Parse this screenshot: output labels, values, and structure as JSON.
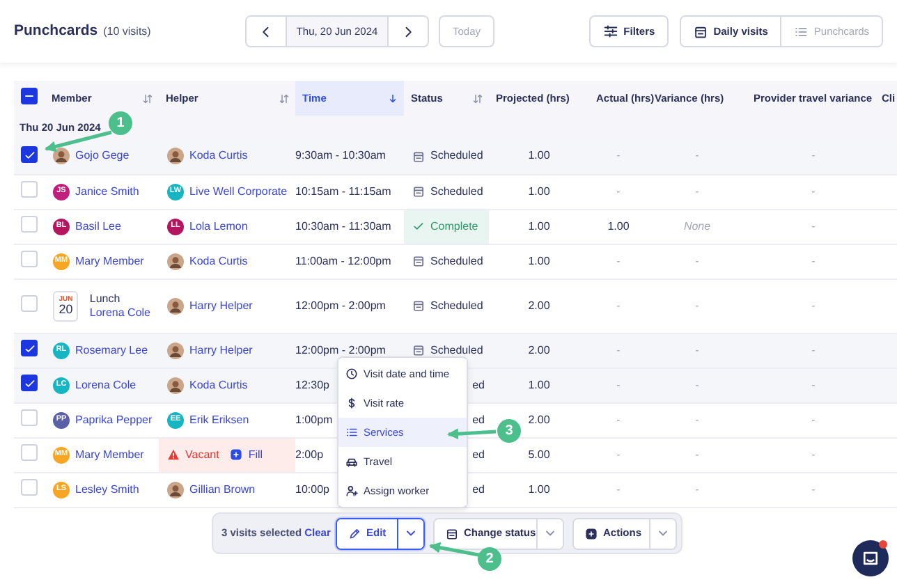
{
  "header": {
    "title": "Punchcards",
    "count": "(10 visits)",
    "date": "Thu, 20 Jun 2024",
    "today": "Today",
    "filters": "Filters",
    "views": [
      {
        "label": "Daily visits",
        "selected": true
      },
      {
        "label": "Punchcards",
        "selected": false
      }
    ]
  },
  "table": {
    "select_all": {
      "indeterminate": true
    },
    "columns": [
      {
        "label": "Member",
        "sortable": true,
        "sorted": false
      },
      {
        "label": "Helper",
        "sortable": true,
        "sorted": false
      },
      {
        "label": "Time",
        "sortable": true,
        "sorted": true
      },
      {
        "label": "Status",
        "sortable": true,
        "sorted": false
      },
      {
        "label": "Projected (hrs)",
        "sortable": false,
        "sorted": false
      },
      {
        "label": "Actual (hrs)",
        "sortable": false,
        "sorted": false
      },
      {
        "label": "Variance (hrs)",
        "sortable": false,
        "sorted": false
      },
      {
        "label": "Provider travel variance",
        "sortable": false,
        "sorted": false
      },
      {
        "label": "Cli",
        "sortable": false,
        "sorted": false
      }
    ],
    "group": "Thu 20 Jun 2024",
    "rows": [
      {
        "checked": true,
        "member": {
          "kind": "photo",
          "name": "Gojo Gege"
        },
        "helper": {
          "kind": "photo",
          "name": "Koda Curtis"
        },
        "time": "9:30am - 10:30am",
        "status": {
          "kind": "scheduled",
          "text": "Scheduled"
        },
        "projected": "1.00",
        "actual": "-",
        "variance": {
          "text": "-",
          "kind": "empty"
        },
        "travel": "-"
      },
      {
        "checked": false,
        "member": {
          "kind": "initials",
          "initials": "JS",
          "color": "#c01f7e",
          "name": "Janice Smith"
        },
        "helper": {
          "kind": "initials",
          "initials": "LW",
          "color": "#16b5c2",
          "name": "Live Well Corporate"
        },
        "time": "10:15am - 11:15am",
        "status": {
          "kind": "scheduled",
          "text": "Scheduled"
        },
        "projected": "1.00",
        "actual": "-",
        "variance": {
          "text": "-",
          "kind": "empty"
        },
        "travel": "-"
      },
      {
        "checked": false,
        "member": {
          "kind": "initials",
          "initials": "BL",
          "color": "#b3165f",
          "name": "Basil Lee"
        },
        "helper": {
          "kind": "initials",
          "initials": "LL",
          "color": "#b3165f",
          "name": "Lola Lemon"
        },
        "time": "10:30am - 11:30am",
        "status": {
          "kind": "complete",
          "text": "Complete"
        },
        "projected": "1.00",
        "actual": "1.00",
        "variance": {
          "text": "None",
          "kind": "none"
        },
        "travel": "-"
      },
      {
        "checked": false,
        "member": {
          "kind": "initials",
          "initials": "MM",
          "color": "#f6a623",
          "name": "Mary Member"
        },
        "helper": {
          "kind": "photo",
          "name": "Koda Curtis"
        },
        "time": "11:00am - 12:00pm",
        "status": {
          "kind": "scheduled",
          "text": "Scheduled"
        },
        "projected": "1.00",
        "actual": "-",
        "variance": {
          "text": "-",
          "kind": "empty"
        },
        "travel": "-"
      },
      {
        "checked": false,
        "member": {
          "kind": "event",
          "month": "JUN",
          "day": "20",
          "label": "Lunch",
          "name": "Lorena Cole"
        },
        "helper": {
          "kind": "photo",
          "name": "Harry Helper"
        },
        "time": "12:00pm - 2:00pm",
        "status": {
          "kind": "scheduled",
          "text": "Scheduled"
        },
        "projected": "2.00",
        "actual": "-",
        "variance": {
          "text": "-",
          "kind": "empty"
        },
        "travel": "-"
      },
      {
        "checked": true,
        "member": {
          "kind": "initials",
          "initials": "RL",
          "color": "#16b5c2",
          "name": "Rosemary Lee"
        },
        "helper": {
          "kind": "photo",
          "name": "Harry Helper"
        },
        "time": "12:00pm - 2:00pm",
        "status": {
          "kind": "scheduled",
          "text": "Scheduled"
        },
        "projected": "2.00",
        "actual": "-",
        "variance": {
          "text": "-",
          "kind": "empty"
        },
        "travel": "-"
      },
      {
        "checked": true,
        "member": {
          "kind": "initials",
          "initials": "LC",
          "color": "#16b5c2",
          "name": "Lorena Cole"
        },
        "helper": {
          "kind": "photo",
          "name": "Koda Curtis"
        },
        "time": "12:30p",
        "status": {
          "kind": "covered",
          "text": "ed"
        },
        "projected": "1.00",
        "actual": "-",
        "variance": {
          "text": "-",
          "kind": "empty"
        },
        "travel": "-"
      },
      {
        "checked": false,
        "member": {
          "kind": "initials",
          "initials": "PP",
          "color": "#5b5fa6",
          "name": "Paprika Pepper"
        },
        "helper": {
          "kind": "initials",
          "initials": "EE",
          "color": "#16b5c2",
          "name": "Erik Eriksen"
        },
        "time": "1:00pm",
        "status": {
          "kind": "covered",
          "text": "ed"
        },
        "projected": "2.00",
        "actual": "-",
        "variance": {
          "text": "-",
          "kind": "empty"
        },
        "travel": "-"
      },
      {
        "checked": false,
        "member": {
          "kind": "initials",
          "initials": "MM",
          "color": "#f6a623",
          "name": "Mary Member"
        },
        "helper": {
          "kind": "vacant",
          "text": "Vacant",
          "action": "Fill"
        },
        "time": "2:00p",
        "status": {
          "kind": "covered",
          "text": "ed"
        },
        "projected": "5.00",
        "actual": "-",
        "variance": {
          "text": "-",
          "kind": "empty"
        },
        "travel": "-"
      },
      {
        "checked": false,
        "member": {
          "kind": "initials",
          "initials": "LS",
          "color": "#f6a623",
          "name": "Lesley Smith"
        },
        "helper": {
          "kind": "photo",
          "name": "Gillian Brown"
        },
        "time": "10:00p",
        "status": {
          "kind": "covered",
          "text": "ed"
        },
        "projected": "1.00",
        "actual": "-",
        "variance": {
          "text": "-",
          "kind": "empty"
        },
        "travel": "-"
      }
    ]
  },
  "menu": [
    {
      "label": "Visit date and time",
      "selected": false
    },
    {
      "label": "Visit rate",
      "selected": false
    },
    {
      "label": "Services",
      "selected": true
    },
    {
      "label": "Travel",
      "selected": false
    },
    {
      "label": "Assign worker",
      "selected": false
    }
  ],
  "bulk_bar": {
    "summary": "3 visits selected",
    "clear": "Clear",
    "actions": [
      {
        "label": "Edit",
        "open": true
      },
      {
        "label": "Change status",
        "open": false
      },
      {
        "label": "Actions",
        "open": false
      }
    ]
  },
  "annotations": [
    {
      "number": "1"
    },
    {
      "number": "2"
    },
    {
      "number": "3"
    }
  ],
  "chat": {
    "unread": true
  }
}
